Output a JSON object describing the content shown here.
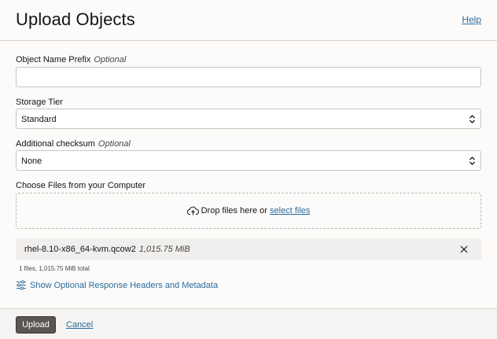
{
  "header": {
    "title": "Upload Objects",
    "help": "Help"
  },
  "form": {
    "prefix": {
      "label": "Object Name Prefix",
      "optional": "Optional",
      "value": ""
    },
    "storage_tier": {
      "label": "Storage Tier",
      "selected": "Standard"
    },
    "checksum": {
      "label": "Additional checksum",
      "optional": "Optional",
      "selected": "None"
    },
    "files": {
      "label": "Choose Files from your Computer",
      "drop_text": "Drop files here or ",
      "select_link": "select files",
      "items": [
        {
          "name": "rhel-8.10-x86_64-kvm.qcow2",
          "size": "1,015.75 MiB"
        }
      ],
      "total": "1 files, 1,015.75 MiB total"
    },
    "metadata_link": "Show Optional Response Headers and Metadata"
  },
  "footer": {
    "upload_label": "Upload",
    "cancel_label": "Cancel"
  },
  "colors": {
    "link": "#2b6b9b",
    "primary_button": "#5b5652"
  },
  "icons": [
    "cloud-upload-icon",
    "chevron-updown-icon",
    "close-icon",
    "sliders-icon"
  ]
}
